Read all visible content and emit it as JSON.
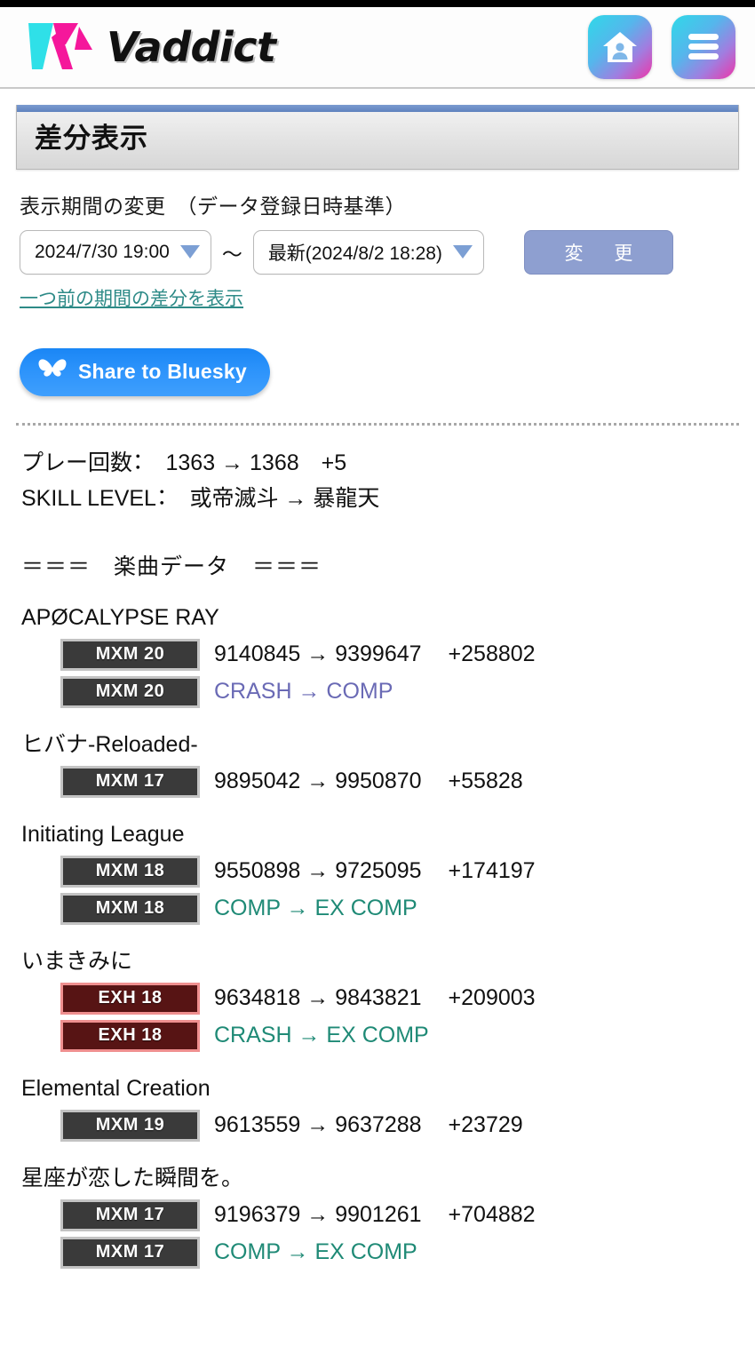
{
  "header": {
    "brand_name": "Vaddict",
    "home_icon": "home-user-icon",
    "menu_icon": "hamburger-menu-icon"
  },
  "page": {
    "title": "差分表示"
  },
  "controls": {
    "label": "表示期間の変更　（データ登録日時基準）",
    "start_value": "2024/7/30 19:00",
    "separator": "～",
    "end_value": "最新(2024/8/2 18:28)",
    "change_button": "変　更",
    "prev_period_link": "一つ前の期間の差分を表示"
  },
  "share": {
    "bluesky_label": "Share to Bluesky",
    "bluesky_icon": "butterfly-icon",
    "bluesky_color": "#2c93fb"
  },
  "summary": {
    "play_count_line": "プレー回数：　1363 → 1368　+5",
    "skill_level_line": "SKILL LEVEL：　或帝滅斗 → 暴龍天"
  },
  "section": {
    "songs_heading": "＝＝＝　楽曲データ　＝＝＝"
  },
  "colors": {
    "mxm_badge_bg": "#3a3a3a",
    "mxm_badge_border": "#c3c3c3",
    "exh_badge_bg": "#571414",
    "exh_badge_border": "#ef8f8f",
    "grade_purple": "#6a6ab5",
    "grade_teal": "#1f8a76",
    "link_teal": "#2d8a87",
    "change_button_bg": "#8e9fd0"
  },
  "songs": [
    {
      "title": "APØCALYPSE RAY",
      "rows": [
        {
          "badge": "MXM 20",
          "badge_type": "mxm",
          "kind": "score",
          "before": "9140845",
          "after": "9399647",
          "gain": "+258802",
          "text": "9140845 → 9399647"
        },
        {
          "badge": "MXM 20",
          "badge_type": "mxm",
          "kind": "grade",
          "grade_color": "purple",
          "text": "CRASH → COMP"
        }
      ]
    },
    {
      "title": "ヒバナ-Reloaded-",
      "rows": [
        {
          "badge": "MXM 17",
          "badge_type": "mxm",
          "kind": "score",
          "before": "9895042",
          "after": "9950870",
          "gain": "+55828",
          "text": "9895042 → 9950870"
        }
      ]
    },
    {
      "title": "Initiating League",
      "rows": [
        {
          "badge": "MXM 18",
          "badge_type": "mxm",
          "kind": "score",
          "before": "9550898",
          "after": "9725095",
          "gain": "+174197",
          "text": "9550898 → 9725095"
        },
        {
          "badge": "MXM 18",
          "badge_type": "mxm",
          "kind": "grade",
          "grade_color": "teal",
          "text": "COMP → EX COMP"
        }
      ]
    },
    {
      "title": "いまきみに",
      "rows": [
        {
          "badge": "EXH 18",
          "badge_type": "exh",
          "kind": "score",
          "before": "9634818",
          "after": "9843821",
          "gain": "+209003",
          "text": "9634818 → 9843821"
        },
        {
          "badge": "EXH 18",
          "badge_type": "exh",
          "kind": "grade",
          "grade_color": "teal",
          "text": "CRASH → EX COMP"
        }
      ]
    },
    {
      "title": "Elemental Creation",
      "rows": [
        {
          "badge": "MXM 19",
          "badge_type": "mxm",
          "kind": "score",
          "before": "9613559",
          "after": "9637288",
          "gain": "+23729",
          "text": "9613559 → 9637288"
        }
      ]
    },
    {
      "title": "星座が恋した瞬間を。",
      "rows": [
        {
          "badge": "MXM 17",
          "badge_type": "mxm",
          "kind": "score",
          "before": "9196379",
          "after": "9901261",
          "gain": "+704882",
          "text": "9196379 → 9901261"
        },
        {
          "badge": "MXM 17",
          "badge_type": "mxm",
          "kind": "grade",
          "grade_color": "teal",
          "text": "COMP → EX COMP"
        }
      ]
    }
  ]
}
